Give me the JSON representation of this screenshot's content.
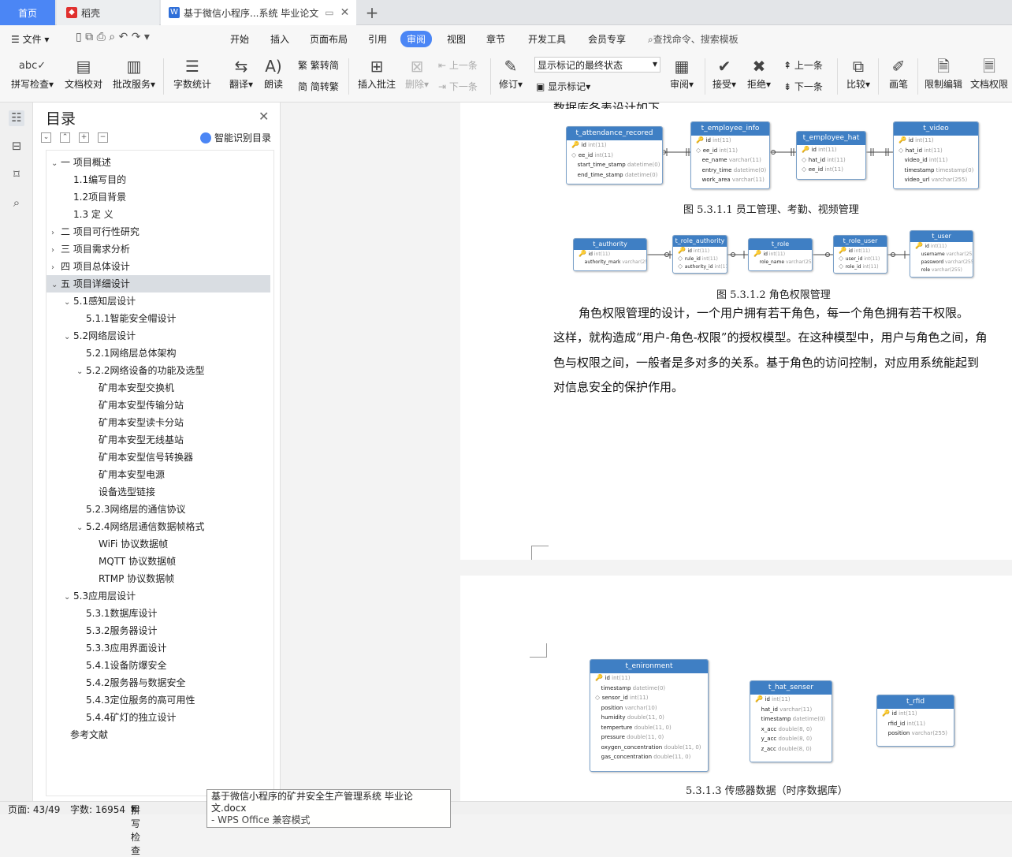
{
  "tabs": {
    "home": "首页",
    "daoke": "稻壳",
    "doc": "基于微信小程序...系统 毕业论文"
  },
  "menu": {
    "file": "文件",
    "items": [
      "开始",
      "插入",
      "页面布局",
      "引用",
      "审阅",
      "视图",
      "章节",
      "开发工具",
      "会员专享"
    ],
    "active": "审阅",
    "search": "查找命令、搜索模板"
  },
  "ribbon": {
    "spell": "拼写检查",
    "proof": "文档校对",
    "annot_service": "批改服务",
    "wordcount": "字数统计",
    "translate": "翻译",
    "read": "朗读",
    "s2t": "繁转简",
    "t2s": "简转繁",
    "insert_comment": "插入批注",
    "delete": "删除",
    "prev": "上一条",
    "next": "下一条",
    "revise": "修订",
    "show_state": "显示标记的最终状态",
    "show_mark": "显示标记",
    "review": "审阅",
    "accept": "接受",
    "reject": "拒绝",
    "prev2": "上一条",
    "next2": "下一条",
    "compare": "比较",
    "pen": "画笔",
    "restrict": "限制编辑",
    "perm": "文档权限"
  },
  "toc": {
    "title": "目录",
    "smart": "智能识别目录",
    "items": [
      {
        "text": "一 项目概述",
        "level": 0,
        "arrow": "v"
      },
      {
        "text": "1.1编写目的",
        "level": 1,
        "arrow": ""
      },
      {
        "text": "1.2项目背景",
        "level": 1,
        "arrow": ""
      },
      {
        "text": "1.3 定 义",
        "level": 1,
        "arrow": ""
      },
      {
        "text": "二 项目可行性研究",
        "level": 0,
        "arrow": ">"
      },
      {
        "text": "三 项目需求分析",
        "level": 0,
        "arrow": ">"
      },
      {
        "text": "四 项目总体设计",
        "level": 0,
        "arrow": ">"
      },
      {
        "text": "五 项目详细设计",
        "level": 0,
        "arrow": "v",
        "selected": true
      },
      {
        "text": "5.1感知层设计",
        "level": 1,
        "arrow": "v"
      },
      {
        "text": "5.1.1智能安全帽设计",
        "level": 2,
        "arrow": ""
      },
      {
        "text": "5.2网络层设计",
        "level": 1,
        "arrow": "v"
      },
      {
        "text": "5.2.1网络层总体架构",
        "level": 2,
        "arrow": ""
      },
      {
        "text": "5.2.2网络设备的功能及选型",
        "level": 2,
        "arrow": "v"
      },
      {
        "text": "矿用本安型交换机",
        "level": 3,
        "arrow": ""
      },
      {
        "text": "矿用本安型传输分站",
        "level": 3,
        "arrow": ""
      },
      {
        "text": "矿用本安型读卡分站",
        "level": 3,
        "arrow": ""
      },
      {
        "text": "矿用本安型无线基站",
        "level": 3,
        "arrow": ""
      },
      {
        "text": "矿用本安型信号转换器",
        "level": 3,
        "arrow": ""
      },
      {
        "text": "矿用本安型电源",
        "level": 3,
        "arrow": ""
      },
      {
        "text": "设备选型链接",
        "level": 3,
        "arrow": ""
      },
      {
        "text": "5.2.3网络层的通信协议",
        "level": 2,
        "arrow": ""
      },
      {
        "text": "5.2.4网络层通信数据帧格式",
        "level": 2,
        "arrow": "v"
      },
      {
        "text": "WiFi 协议数据帧",
        "level": 3,
        "arrow": ""
      },
      {
        "text": "MQTT 协议数据帧",
        "level": 3,
        "arrow": ""
      },
      {
        "text": "RTMP 协议数据帧",
        "level": 3,
        "arrow": ""
      },
      {
        "text": "5.3应用层设计",
        "level": 1,
        "arrow": "v"
      },
      {
        "text": "5.3.1数据库设计",
        "level": 2,
        "arrow": ""
      },
      {
        "text": "5.3.2服务器设计",
        "level": 2,
        "arrow": ""
      },
      {
        "text": "5.3.3应用界面设计",
        "level": 2,
        "arrow": ""
      },
      {
        "text": "5.4.1设备防爆安全",
        "level": 2,
        "arrow": ""
      },
      {
        "text": "5.4.2服务器与数据安全",
        "level": 2,
        "arrow": ""
      },
      {
        "text": "5.4.3定位服务的高可用性",
        "level": 2,
        "arrow": ""
      },
      {
        "text": "5.4.4矿灯的独立设计",
        "level": 2,
        "arrow": ""
      },
      {
        "text": "参考文献",
        "level": 0.5,
        "arrow": ""
      }
    ]
  },
  "doc": {
    "heading_cut": "数据库各表设计如下",
    "cap1": "图 5.3.1.1 员工管理、考勤、视频管理",
    "cap2": "图 5.3.1.2 角色权限管理",
    "para": [
      "角色权限管理的设计，一个用户拥有若干角色，每一个角色拥有若干权限。",
      "这样，就构造成“用户-角色-权限”的授权模型。在这种模型中，用户与角色之间，角",
      "色与权限之间，一般者是多对多的关系。基于角色的访问控制，对应用系统能起到",
      "对信息安全的保护作用。"
    ],
    "cap3": "5.3.1.3 传感器数据（时序数据库）"
  },
  "tables": {
    "attendance": {
      "name": "t_attendance_recored",
      "rows": [
        [
          "k",
          "id",
          "int(11)"
        ],
        [
          "d",
          "ee_id",
          "int(11)"
        ],
        [
          "",
          "start_time_stamp",
          "datetime(0)"
        ],
        [
          "",
          "end_time_stamp",
          "datetime(0)"
        ]
      ]
    },
    "employee_info": {
      "name": "t_employee_info",
      "rows": [
        [
          "k",
          "id",
          "int(11)"
        ],
        [
          "d",
          "ee_id",
          "int(11)"
        ],
        [
          "",
          "ee_name",
          "varchar(11)"
        ],
        [
          "",
          "entry_time",
          "datetime(0)"
        ],
        [
          "",
          "work_area",
          "varchar(11)"
        ]
      ]
    },
    "employee_hat": {
      "name": "t_employee_hat",
      "rows": [
        [
          "k",
          "id",
          "int(11)"
        ],
        [
          "d",
          "hat_id",
          "int(11)"
        ],
        [
          "d",
          "ee_id",
          "int(11)"
        ]
      ]
    },
    "video": {
      "name": "t_video",
      "rows": [
        [
          "k",
          "id",
          "int(11)"
        ],
        [
          "d",
          "hat_id",
          "int(11)"
        ],
        [
          "",
          "video_id",
          "int(11)"
        ],
        [
          "",
          "timestamp",
          "timestamp(0)"
        ],
        [
          "",
          "video_url",
          "varchar(255)"
        ]
      ]
    },
    "authority": {
      "name": "t_authority",
      "rows": [
        [
          "k",
          "id",
          "int(11)"
        ],
        [
          "",
          "authority_mark",
          "varchar(255)"
        ]
      ]
    },
    "role_authority": {
      "name": "t_role_authority",
      "rows": [
        [
          "k",
          "id",
          "int(11)"
        ],
        [
          "d",
          "rule_id",
          "int(11)"
        ],
        [
          "d",
          "authority_id",
          "int(11)"
        ]
      ]
    },
    "role": {
      "name": "t_role",
      "rows": [
        [
          "k",
          "id",
          "int(11)"
        ],
        [
          "",
          "role_name",
          "varchar(255)"
        ]
      ]
    },
    "role_user": {
      "name": "t_role_user",
      "rows": [
        [
          "k",
          "id",
          "int(11)"
        ],
        [
          "d",
          "user_id",
          "int(11)"
        ],
        [
          "d",
          "role_id",
          "int(11)"
        ]
      ]
    },
    "user": {
      "name": "t_user",
      "rows": [
        [
          "k",
          "id",
          "int(11)"
        ],
        [
          "",
          "username",
          "varchar(255)"
        ],
        [
          "",
          "password",
          "varchar(255)"
        ],
        [
          "",
          "role",
          "varchar(255)"
        ]
      ]
    },
    "enironment": {
      "name": "t_enironment",
      "rows": [
        [
          "k",
          "id",
          "int(11)"
        ],
        [
          "",
          "timestamp",
          "datetime(0)"
        ],
        [
          "d",
          "sensor_id",
          "int(11)"
        ],
        [
          "",
          "position",
          "varchar(10)"
        ],
        [
          "",
          "humidity",
          "double(11, 0)"
        ],
        [
          "",
          "temperture",
          "double(11, 0)"
        ],
        [
          "",
          "pressure",
          "double(11, 0)"
        ],
        [
          "",
          "oxygen_concentration",
          "double(11, 0)"
        ],
        [
          "",
          "gas_concentration",
          "double(11, 0)"
        ]
      ]
    },
    "hat_senser": {
      "name": "t_hat_senser",
      "rows": [
        [
          "k",
          "id",
          "int(11)"
        ],
        [
          "",
          "hat_id",
          "varchar(11)"
        ],
        [
          "",
          "timestamp",
          "datetime(0)"
        ],
        [
          "",
          "x_acc",
          "double(8, 0)"
        ],
        [
          "",
          "y_acc",
          "double(8, 0)"
        ],
        [
          "",
          "z_acc",
          "double(8, 0)"
        ]
      ]
    },
    "rfid": {
      "name": "t_rfid",
      "rows": [
        [
          "k",
          "id",
          "int(11)"
        ],
        [
          "",
          "rfid_id",
          "int(11)"
        ],
        [
          "",
          "position",
          "varchar(255)"
        ]
      ]
    }
  },
  "status": {
    "page": "页面: 43/49",
    "words": "字数: 16954",
    "spell": "拼写检查"
  },
  "tooltip": {
    "line1": "基于微信小程序的矿井安全生产管理系统 毕业论文.docx",
    "line2": "- WPS Office 兼容模式"
  }
}
